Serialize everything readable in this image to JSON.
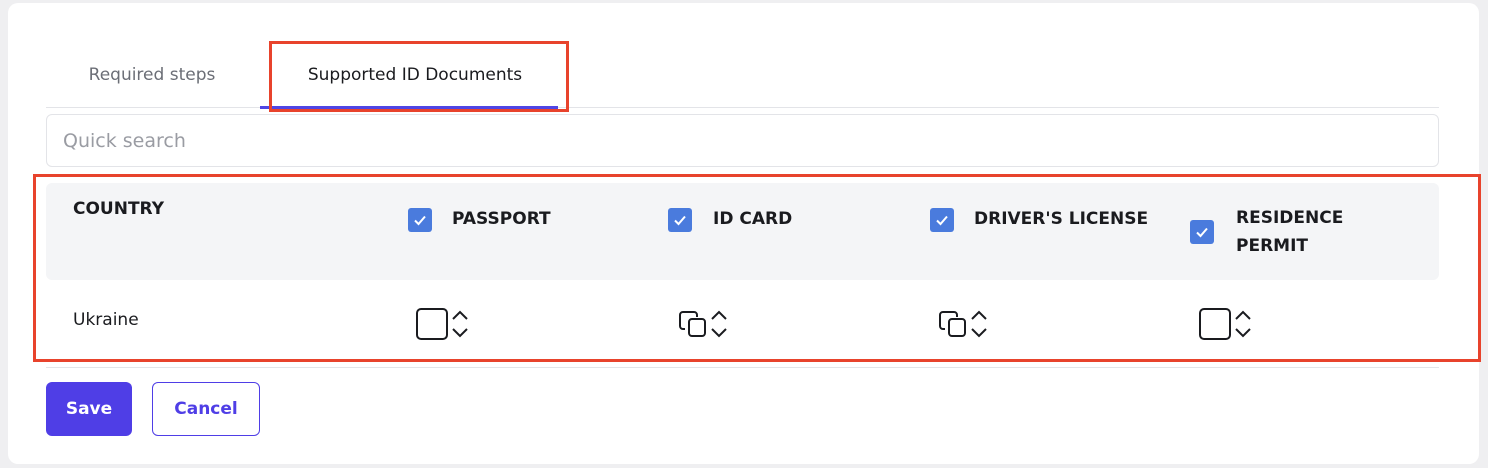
{
  "tabs": [
    {
      "label": "Required steps",
      "active": false
    },
    {
      "label": "Supported ID Documents",
      "active": true
    }
  ],
  "search": {
    "placeholder": "Quick search",
    "value": ""
  },
  "table": {
    "country_header": "COUNTRY",
    "columns": [
      {
        "label": "PASSPORT",
        "checked": true
      },
      {
        "label": "ID CARD",
        "checked": true
      },
      {
        "label": "DRIVER'S LICENSE",
        "checked": true
      },
      {
        "label": "RESIDENCE",
        "label2": "PERMIT",
        "checked": true
      }
    ],
    "rows": [
      {
        "country": "Ukraine",
        "cells": [
          "single-page-icon",
          "copy-icon",
          "copy-icon",
          "single-page-icon"
        ]
      }
    ]
  },
  "buttons": {
    "save": "Save",
    "cancel": "Cancel"
  },
  "colors": {
    "accent": "#4f3ee6",
    "checkbox": "#4a7bdd",
    "highlight": "#e8432c"
  }
}
